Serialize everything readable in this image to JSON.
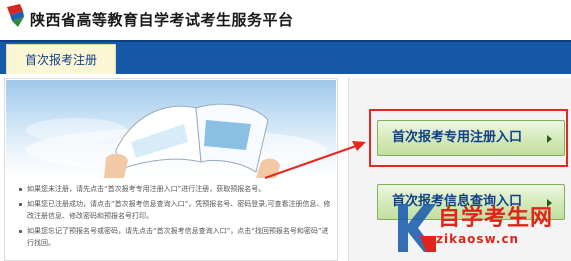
{
  "header": {
    "title": "陕西省高等教育自学考试考生服务平台",
    "logo_icon": "graduation-cap-logo-icon"
  },
  "nav": {
    "active_tab": "首次报考注册"
  },
  "tips": [
    "如果您未注册，请先点击“首次报考专用注册入口”进行注册，获取预报名号。",
    "如果您已注册成功，请点击“首次报考信息查询入口”，凭预报名号、密码登录,可查看注册信息、修改注册信息、修改密码和预报名号打印。",
    "如果您忘记了预报名号或密码，请先点击“首次报考信息查询入口”，点击“找回预报名号和密码”进行找回。"
  ],
  "buttons": {
    "register": "首次报考专用注册入口",
    "query": "首次报考信息查询入口"
  },
  "watermark": {
    "cn": "自学考生网",
    "en": "zikaosw.cn"
  },
  "colors": {
    "nav_bg": "#1759a9",
    "tab_bg": "#fbf6d3",
    "button_green": "#d3e9b8",
    "highlight_red": "#e8281f"
  }
}
